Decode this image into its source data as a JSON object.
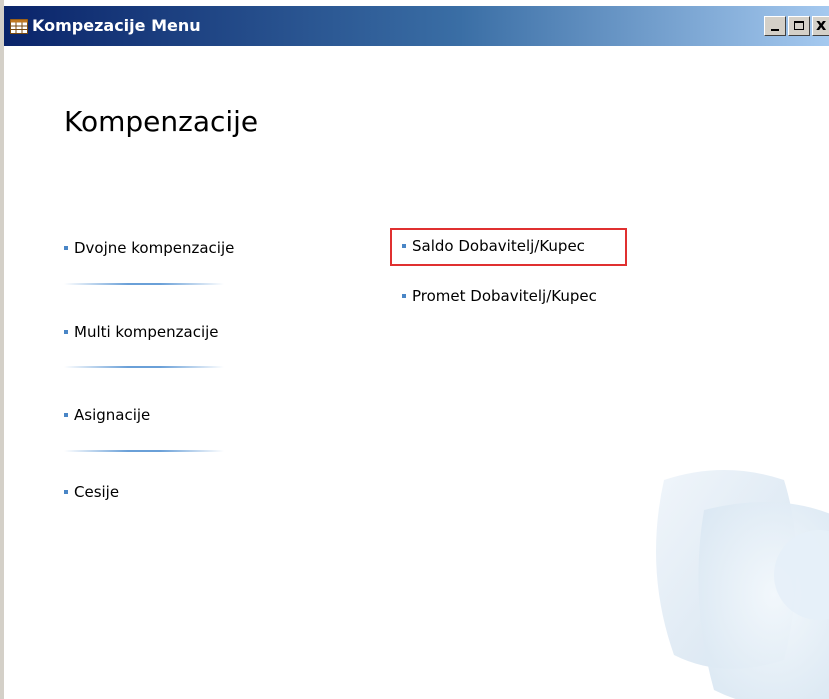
{
  "window": {
    "title": "Kompezacije Menu",
    "icons": {
      "app": "table-icon",
      "minimize": "minimize-icon",
      "maximize": "maximize-icon",
      "close": "close-icon"
    },
    "close_glyph": "x"
  },
  "main": {
    "heading": "Kompenzacije",
    "left_menu": [
      {
        "label": "Dvojne kompenzacije"
      },
      {
        "label": "Multi kompenzacije"
      },
      {
        "label": "Asignacije"
      },
      {
        "label": "Cesije"
      }
    ],
    "right_menu": [
      {
        "label": "Saldo Dobavitelj/Kupec",
        "highlighted": true
      },
      {
        "label": "Promet Dobavitelj/Kupec",
        "highlighted": false
      }
    ]
  },
  "colors": {
    "titlebar_start": "#0a246a",
    "titlebar_end": "#a6caf0",
    "bullet": "#4a86c6",
    "highlight_border": "#e03030"
  }
}
